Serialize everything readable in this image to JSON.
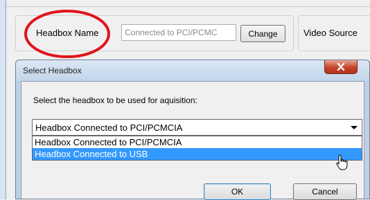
{
  "background": {
    "headbox_label": "Headbox Name",
    "headbox_field_value": "Connected to PCI/PCMC",
    "change_button": "Change",
    "video_source_label": "Video Source",
    "highlight_color": "#e0141b"
  },
  "dialog": {
    "title": "Select Headbox",
    "close_glyph": "x",
    "prompt": "Select the headbox to be used for aquisition:",
    "combo_value": "Headbox Connected to PCI/PCMCIA",
    "options": [
      "Headbox Connected to PCI/PCMCIA",
      "Headbox Connected to USB"
    ],
    "selected_option_index": 1,
    "ok_button": "OK",
    "cancel_button": "Cancel",
    "selection_color": "#3399ff"
  }
}
